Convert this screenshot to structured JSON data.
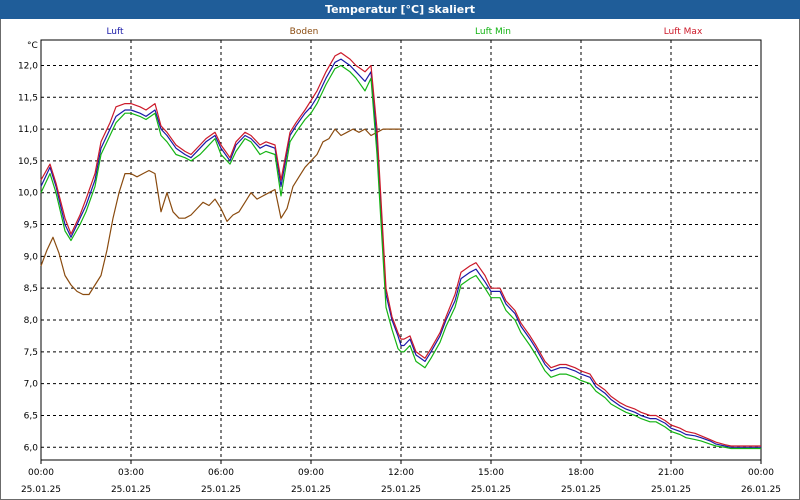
{
  "window": {
    "title": "Temperatur [°C] skaliert"
  },
  "chart_data": {
    "type": "line",
    "y_unit": "°C",
    "ylim": [
      5.8,
      12.4
    ],
    "y_ticks": [
      "6,0",
      "6,5",
      "7,0",
      "7,5",
      "8,0",
      "8,5",
      "9,0",
      "9,5",
      "10,0",
      "10,5",
      "11,0",
      "11,5",
      "12,0"
    ],
    "x_ticks": [
      {
        "time": "00:00",
        "date": "25.01.25"
      },
      {
        "time": "03:00",
        "date": "25.01.25"
      },
      {
        "time": "06:00",
        "date": "25.01.25"
      },
      {
        "time": "09:00",
        "date": "25.01.25"
      },
      {
        "time": "12:00",
        "date": "25.01.25"
      },
      {
        "time": "15:00",
        "date": "25.01.25"
      },
      {
        "time": "18:00",
        "date": "25.01.25"
      },
      {
        "time": "21:00",
        "date": "25.01.25"
      },
      {
        "time": "00:00",
        "date": "26.01.25"
      }
    ],
    "xlim_hours": [
      0,
      24
    ],
    "grid": true,
    "legend_position": "top",
    "series": [
      {
        "name": "Luft",
        "color": "#1a1aa8",
        "x": [
          0,
          0.3,
          0.5,
          0.8,
          1.0,
          1.3,
          1.5,
          1.8,
          2.0,
          2.3,
          2.5,
          2.8,
          3.0,
          3.3,
          3.5,
          3.8,
          4.0,
          4.2,
          4.5,
          4.8,
          5.0,
          5.3,
          5.5,
          5.8,
          6.0,
          6.3,
          6.5,
          6.8,
          7.0,
          7.3,
          7.5,
          7.8,
          8.0,
          8.3,
          8.5,
          8.8,
          9.0,
          9.2,
          9.5,
          9.8,
          10.0,
          10.3,
          10.5,
          10.8,
          11.0,
          11.2,
          11.5,
          11.7,
          11.9,
          12.0,
          12.1,
          12.3,
          12.5,
          12.8,
          13.0,
          13.3,
          13.5,
          13.8,
          14.0,
          14.3,
          14.5,
          14.8,
          15.0,
          15.3,
          15.5,
          15.8,
          16.0,
          16.3,
          16.5,
          16.8,
          17.0,
          17.3,
          17.5,
          17.8,
          18.0,
          18.3,
          18.5,
          18.8,
          19.0,
          19.3,
          19.5,
          19.8,
          20.0,
          20.3,
          20.5,
          20.8,
          21.0,
          21.3,
          21.5,
          21.8,
          22.0,
          22.3,
          22.5,
          22.8,
          23.0,
          23.3,
          23.5,
          23.8,
          24.0
        ],
        "y": [
          10.1,
          10.4,
          10.1,
          9.5,
          9.3,
          9.6,
          9.8,
          10.2,
          10.7,
          11.0,
          11.2,
          11.3,
          11.3,
          11.25,
          11.2,
          11.3,
          11.0,
          10.9,
          10.7,
          10.6,
          10.55,
          10.7,
          10.8,
          10.9,
          10.7,
          10.5,
          10.75,
          10.9,
          10.85,
          10.7,
          10.75,
          10.7,
          10.1,
          10.9,
          11.05,
          11.25,
          11.35,
          11.5,
          11.8,
          12.05,
          12.1,
          12.0,
          11.9,
          11.75,
          11.9,
          10.8,
          8.4,
          8.0,
          7.75,
          7.6,
          7.6,
          7.7,
          7.45,
          7.35,
          7.5,
          7.75,
          8.0,
          8.3,
          8.65,
          8.75,
          8.8,
          8.6,
          8.45,
          8.45,
          8.25,
          8.1,
          7.9,
          7.7,
          7.55,
          7.3,
          7.2,
          7.25,
          7.25,
          7.2,
          7.15,
          7.1,
          6.95,
          6.85,
          6.75,
          6.65,
          6.6,
          6.55,
          6.5,
          6.45,
          6.45,
          6.38,
          6.3,
          6.25,
          6.2,
          6.18,
          6.15,
          6.1,
          6.05,
          6.02,
          6.0,
          6.0,
          6.0,
          6.0,
          6.0
        ]
      },
      {
        "name": "Boden",
        "color": "#8a4b0f",
        "x": [
          0,
          0.2,
          0.4,
          0.6,
          0.8,
          1.0,
          1.2,
          1.4,
          1.6,
          1.8,
          2.0,
          2.2,
          2.4,
          2.6,
          2.8,
          3.0,
          3.2,
          3.4,
          3.6,
          3.8,
          4.0,
          4.2,
          4.4,
          4.6,
          4.8,
          5.0,
          5.2,
          5.4,
          5.6,
          5.8,
          6.0,
          6.2,
          6.4,
          6.6,
          6.8,
          7.0,
          7.2,
          7.4,
          7.6,
          7.8,
          8.0,
          8.2,
          8.4,
          8.6,
          8.8,
          9.0,
          9.2,
          9.4,
          9.6,
          9.8,
          10.0,
          10.2,
          10.4,
          10.6,
          10.8,
          11.0,
          11.2,
          11.4,
          11.6,
          11.8,
          12.0
        ],
        "y": [
          8.85,
          9.1,
          9.3,
          9.05,
          8.7,
          8.55,
          8.45,
          8.4,
          8.4,
          8.55,
          8.7,
          9.1,
          9.6,
          10.0,
          10.3,
          10.3,
          10.25,
          10.3,
          10.35,
          10.3,
          9.7,
          10.0,
          9.7,
          9.6,
          9.6,
          9.65,
          9.75,
          9.85,
          9.8,
          9.9,
          9.75,
          9.55,
          9.65,
          9.7,
          9.85,
          10.0,
          9.9,
          9.95,
          10.0,
          10.05,
          9.6,
          9.75,
          10.1,
          10.25,
          10.4,
          10.5,
          10.6,
          10.8,
          10.85,
          11.0,
          10.9,
          10.95,
          11.0,
          10.95,
          11.0,
          10.9,
          10.95,
          11.0,
          11.0,
          11.0,
          11.0
        ]
      },
      {
        "name": "Luft Min",
        "color": "#14b414",
        "x": [
          0,
          0.3,
          0.5,
          0.8,
          1.0,
          1.3,
          1.5,
          1.8,
          2.0,
          2.3,
          2.5,
          2.8,
          3.0,
          3.3,
          3.5,
          3.8,
          4.0,
          4.2,
          4.5,
          4.8,
          5.0,
          5.3,
          5.5,
          5.8,
          6.0,
          6.3,
          6.5,
          6.8,
          7.0,
          7.3,
          7.5,
          7.8,
          8.0,
          8.3,
          8.5,
          8.8,
          9.0,
          9.2,
          9.5,
          9.8,
          10.0,
          10.3,
          10.5,
          10.8,
          11.0,
          11.2,
          11.5,
          11.7,
          11.9,
          12.0,
          12.1,
          12.3,
          12.5,
          12.8,
          13.0,
          13.3,
          13.5,
          13.8,
          14.0,
          14.3,
          14.5,
          14.8,
          15.0,
          15.3,
          15.5,
          15.8,
          16.0,
          16.3,
          16.5,
          16.8,
          17.0,
          17.3,
          17.5,
          17.8,
          18.0,
          18.3,
          18.5,
          18.8,
          19.0,
          19.3,
          19.5,
          19.8,
          20.0,
          20.3,
          20.5,
          20.8,
          21.0,
          21.3,
          21.5,
          21.8,
          22.0,
          22.3,
          22.5,
          22.8,
          23.0,
          23.3,
          23.5,
          23.8,
          24.0
        ],
        "y": [
          10.0,
          10.3,
          10.0,
          9.4,
          9.25,
          9.5,
          9.7,
          10.1,
          10.6,
          10.9,
          11.1,
          11.25,
          11.25,
          11.2,
          11.15,
          11.25,
          10.9,
          10.8,
          10.6,
          10.55,
          10.5,
          10.6,
          10.7,
          10.85,
          10.6,
          10.45,
          10.65,
          10.85,
          10.8,
          10.6,
          10.65,
          10.6,
          9.95,
          10.8,
          10.95,
          11.15,
          11.25,
          11.4,
          11.7,
          11.95,
          12.0,
          11.9,
          11.8,
          11.6,
          11.8,
          10.6,
          8.2,
          7.85,
          7.55,
          7.5,
          7.5,
          7.6,
          7.35,
          7.25,
          7.4,
          7.65,
          7.9,
          8.2,
          8.55,
          8.65,
          8.7,
          8.5,
          8.35,
          8.35,
          8.15,
          8.0,
          7.8,
          7.6,
          7.45,
          7.2,
          7.1,
          7.15,
          7.15,
          7.1,
          7.05,
          7.0,
          6.88,
          6.78,
          6.68,
          6.6,
          6.55,
          6.5,
          6.45,
          6.4,
          6.4,
          6.32,
          6.25,
          6.2,
          6.15,
          6.12,
          6.1,
          6.05,
          6.02,
          6.0,
          5.98,
          5.98,
          5.98,
          5.98,
          5.98
        ]
      },
      {
        "name": "Luft Max",
        "color": "#cc1a2a",
        "x": [
          0,
          0.3,
          0.5,
          0.8,
          1.0,
          1.3,
          1.5,
          1.8,
          2.0,
          2.3,
          2.5,
          2.8,
          3.0,
          3.3,
          3.5,
          3.8,
          4.0,
          4.2,
          4.5,
          4.8,
          5.0,
          5.3,
          5.5,
          5.8,
          6.0,
          6.3,
          6.5,
          6.8,
          7.0,
          7.3,
          7.5,
          7.8,
          8.0,
          8.3,
          8.5,
          8.8,
          9.0,
          9.2,
          9.5,
          9.8,
          10.0,
          10.3,
          10.5,
          10.8,
          11.0,
          11.2,
          11.5,
          11.7,
          11.9,
          12.0,
          12.1,
          12.3,
          12.5,
          12.8,
          13.0,
          13.3,
          13.5,
          13.8,
          14.0,
          14.3,
          14.5,
          14.8,
          15.0,
          15.3,
          15.5,
          15.8,
          16.0,
          16.3,
          16.5,
          16.8,
          17.0,
          17.3,
          17.5,
          17.8,
          18.0,
          18.3,
          18.5,
          18.8,
          19.0,
          19.3,
          19.5,
          19.8,
          20.0,
          20.3,
          20.5,
          20.8,
          21.0,
          21.3,
          21.5,
          21.8,
          22.0,
          22.3,
          22.5,
          22.8,
          23.0,
          23.3,
          23.5,
          23.8,
          24.0
        ],
        "y": [
          10.2,
          10.45,
          10.15,
          9.6,
          9.35,
          9.65,
          9.9,
          10.3,
          10.8,
          11.1,
          11.35,
          11.4,
          11.4,
          11.35,
          11.3,
          11.4,
          11.05,
          10.95,
          10.75,
          10.65,
          10.6,
          10.75,
          10.85,
          10.95,
          10.75,
          10.55,
          10.8,
          10.95,
          10.9,
          10.75,
          10.8,
          10.75,
          10.2,
          10.95,
          11.1,
          11.3,
          11.45,
          11.6,
          11.9,
          12.15,
          12.2,
          12.1,
          12.0,
          11.9,
          12.0,
          11.0,
          8.5,
          8.05,
          7.8,
          7.7,
          7.7,
          7.75,
          7.5,
          7.4,
          7.55,
          7.8,
          8.05,
          8.4,
          8.75,
          8.85,
          8.9,
          8.7,
          8.5,
          8.5,
          8.3,
          8.15,
          7.95,
          7.75,
          7.6,
          7.35,
          7.25,
          7.3,
          7.3,
          7.25,
          7.2,
          7.15,
          7.0,
          6.9,
          6.8,
          6.7,
          6.65,
          6.6,
          6.55,
          6.5,
          6.5,
          6.42,
          6.35,
          6.3,
          6.25,
          6.22,
          6.18,
          6.12,
          6.08,
          6.04,
          6.02,
          6.02,
          6.02,
          6.02,
          6.02
        ]
      }
    ]
  }
}
